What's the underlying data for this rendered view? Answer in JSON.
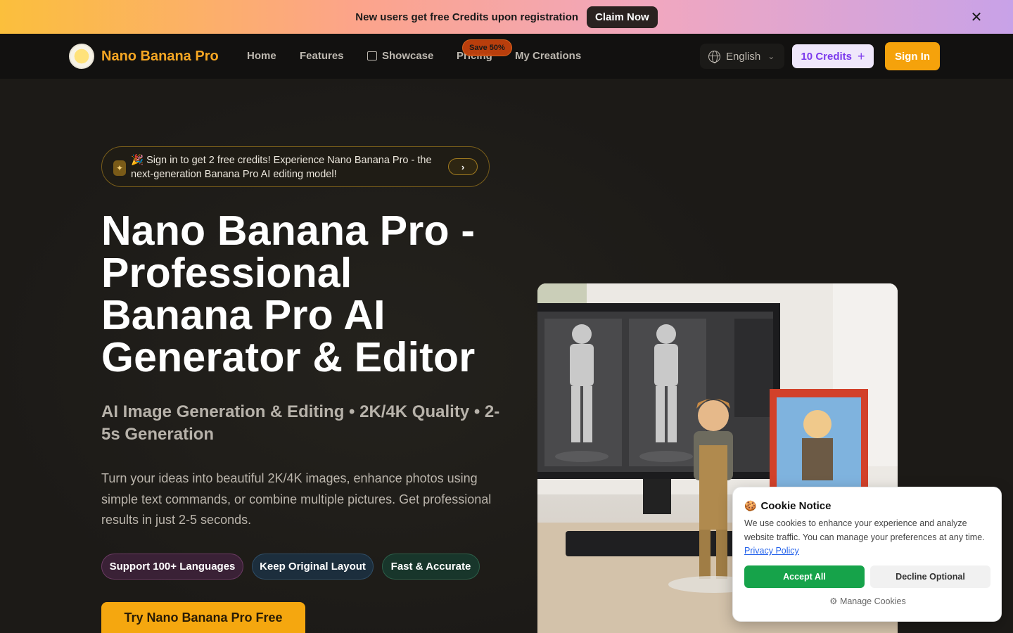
{
  "promo": {
    "message": "New users get free Credits upon registration",
    "cta_label": "Claim Now",
    "close_glyph": "✕"
  },
  "nav": {
    "brand": "Nano Banana Pro",
    "links": {
      "home": "Home",
      "features": "Features",
      "showcase": "Showcase",
      "pricing": "Pricing",
      "my_creations": "My Creations"
    },
    "pricing_badge": "Save 50%",
    "language": "English",
    "credits": "10 Credits",
    "sign_in": "Sign In"
  },
  "hero": {
    "announcement": "🎉 Sign in to get 2 free credits! Experience Nano Banana Pro - the next-generation Banana Pro AI editing model!",
    "title": "Nano Banana Pro - Professional Banana Pro AI Generator & Editor",
    "subtitle": "AI Image Generation & Editing • 2K/4K Quality • 2-5s Generation",
    "description": "Turn your ideas into beautiful 2K/4K images, enhance photos using simple text commands, or combine multiple pictures. Get professional results in just 2-5 seconds.",
    "tags": [
      "Support 100+ Languages",
      "Keep Original Layout",
      "Fast & Accurate"
    ],
    "cta": "Try Nano Banana Pro Free"
  },
  "cookie": {
    "title": "Cookie Notice",
    "text": "We use cookies to enhance your experience and analyze website traffic. You can manage your preferences at any time.",
    "link": "Privacy Policy",
    "accept": "Accept All",
    "decline": "Decline Optional",
    "manage": "Manage Cookies"
  },
  "colors": {
    "brand": "#f5a623",
    "accent_purple": "#7c3aed",
    "accept_green": "#16a34a"
  },
  "icons": [
    "close-icon",
    "banana-logo-icon",
    "image-icon",
    "globe-icon",
    "chevron-down-icon",
    "plus-icon",
    "sparkle-icon",
    "chevron-right-icon",
    "cookie-icon",
    "gear-icon"
  ]
}
